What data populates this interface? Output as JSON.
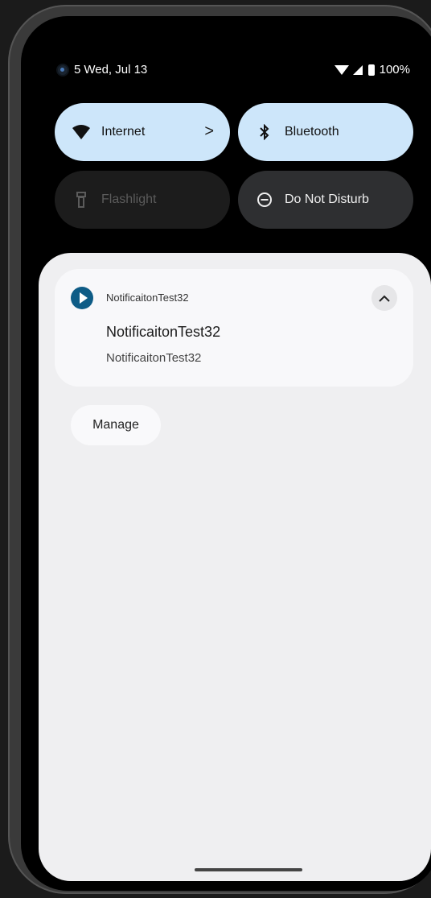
{
  "status_bar": {
    "time_fragment": "5",
    "date": "Wed, Jul 13",
    "battery": "100%",
    "icons": [
      "camera-icon",
      "wifi-icon",
      "signal-icon",
      "battery-icon"
    ]
  },
  "quick_settings": {
    "tiles": [
      {
        "label": "Internet",
        "icon": "wifi-icon",
        "state": "on",
        "has_chevron": true
      },
      {
        "label": "Bluetooth",
        "icon": "bluetooth-icon",
        "state": "on"
      },
      {
        "label": "Flashlight",
        "icon": "flashlight-icon",
        "state": "unavailable"
      },
      {
        "label": "Do Not Disturb",
        "icon": "do-not-disturb-icon",
        "state": "off"
      }
    ],
    "chevron_symbol": ">"
  },
  "notification": {
    "app_name": "NotificaitonTest32",
    "title": "NotificaitonTest32",
    "text": "NotificaitonTest32",
    "app_icon": "play-icon",
    "expand_icon": "chevron-up-icon"
  },
  "shade": {
    "manage_label": "Manage"
  },
  "colors": {
    "tile_active": "#cde6fa",
    "tile_dark": "#2e2f31",
    "shade_bg": "#efeff1",
    "app_icon_bg": "#0e5c86"
  }
}
